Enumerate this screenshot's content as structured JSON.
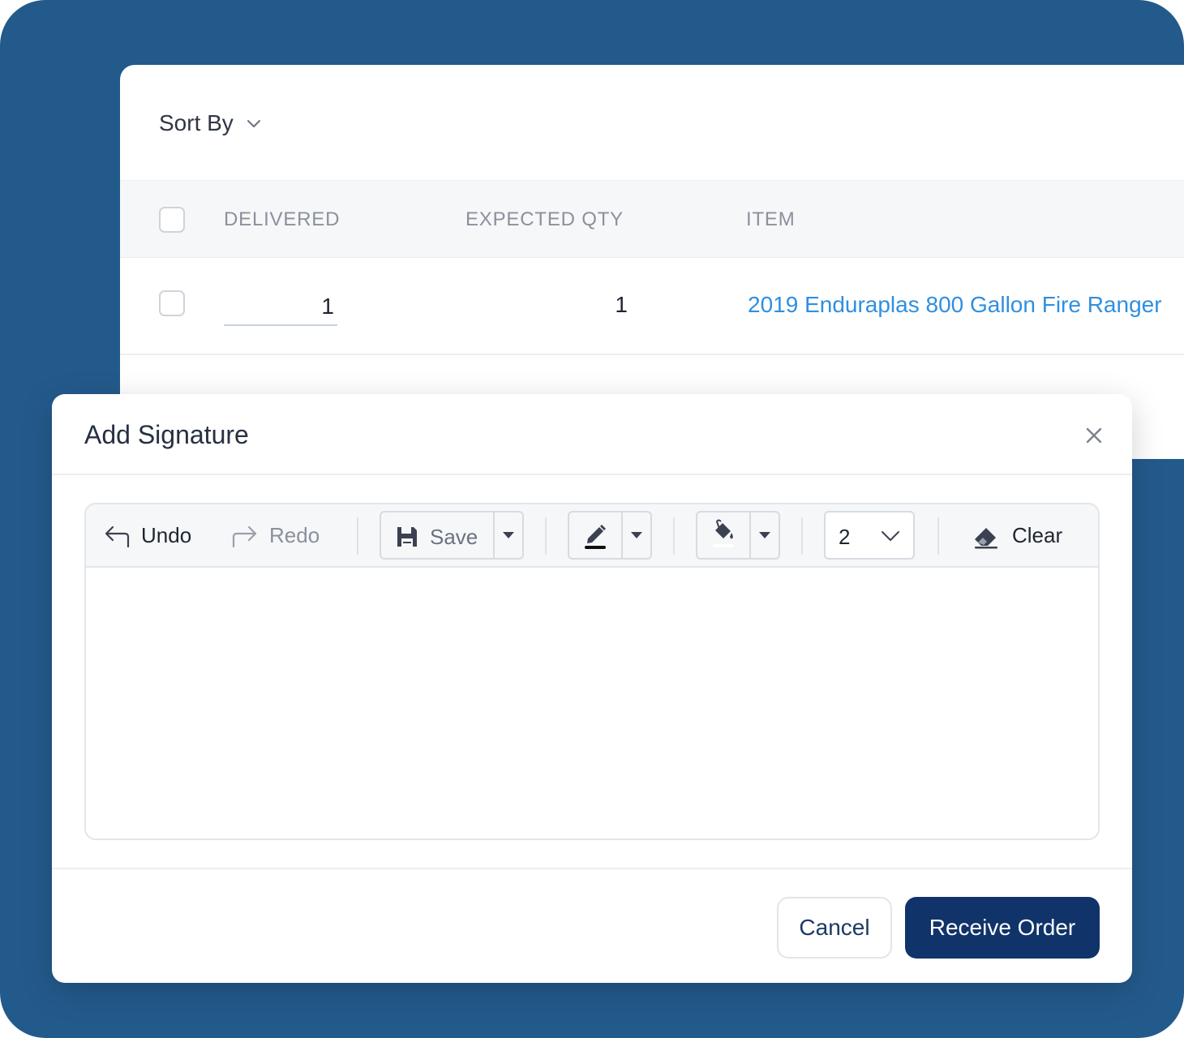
{
  "list": {
    "sort_label": "Sort By",
    "columns": [
      "DELIVERED",
      "EXPECTED QTY",
      "ITEM"
    ],
    "rows": [
      {
        "delivered": "1",
        "expected_qty": "1",
        "item": "2019 Enduraplas 800 Gallon Fire Ranger"
      }
    ],
    "link_color": "#2f8fe0"
  },
  "modal": {
    "title": "Add Signature",
    "toolbar": {
      "undo": "Undo",
      "redo": "Redo",
      "save": "Save",
      "pen_width": "2",
      "clear": "Clear"
    },
    "footer": {
      "cancel": "Cancel",
      "submit": "Receive Order"
    }
  },
  "colors": {
    "background": "#235a8c",
    "primary_button": "#10336a"
  }
}
